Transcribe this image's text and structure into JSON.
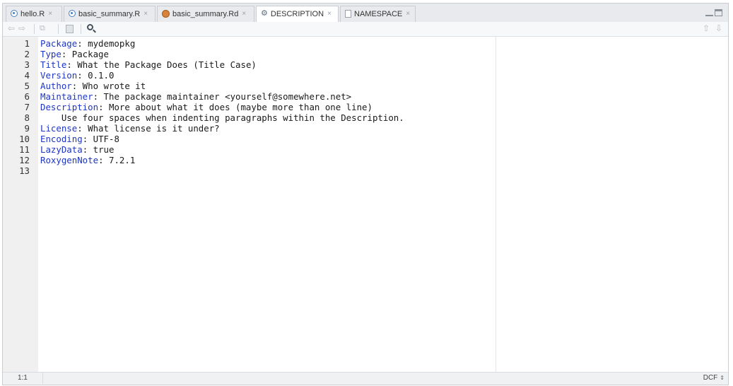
{
  "tabs": [
    {
      "label": "hello.R",
      "icon": "r-file-icon",
      "active": false
    },
    {
      "label": "basic_summary.R",
      "icon": "r-file-icon",
      "active": false
    },
    {
      "label": "basic_summary.Rd",
      "icon": "rd-file-icon",
      "active": false
    },
    {
      "label": "DESCRIPTION",
      "icon": "gear-icon",
      "active": true
    },
    {
      "label": "NAMESPACE",
      "icon": "page-icon",
      "active": false
    }
  ],
  "tab_close_glyph": "×",
  "toolbar": {
    "back_icon": "back-arrow-icon",
    "forward_icon": "forward-arrow-icon",
    "show_in_window_icon": "show-in-window-icon",
    "save_icon": "save-icon",
    "find_icon": "search-icon",
    "up_icon": "arrow-up-icon",
    "down_icon": "arrow-down-icon"
  },
  "editor": {
    "lines": [
      {
        "n": "1",
        "key": "Package",
        "rest": ": mydemopkg"
      },
      {
        "n": "2",
        "key": "Type",
        "rest": ": Package"
      },
      {
        "n": "3",
        "key": "Title",
        "rest": ": What the Package Does (Title Case)"
      },
      {
        "n": "4",
        "key": "Version",
        "rest": ": 0.1.0"
      },
      {
        "n": "5",
        "key": "Author",
        "rest": ": Who wrote it"
      },
      {
        "n": "6",
        "key": "Maintainer",
        "rest": ": The package maintainer <yourself@somewhere.net>"
      },
      {
        "n": "7",
        "key": "Description",
        "rest": ": More about what it does (maybe more than one line)"
      },
      {
        "n": "8",
        "key": "",
        "rest": "    Use four spaces when indenting paragraphs within the Description."
      },
      {
        "n": "9",
        "key": "License",
        "rest": ": What license is it under?"
      },
      {
        "n": "10",
        "key": "Encoding",
        "rest": ": UTF-8"
      },
      {
        "n": "11",
        "key": "LazyData",
        "rest": ": true"
      },
      {
        "n": "12",
        "key": "RoxygenNote",
        "rest": ": 7.2.1"
      },
      {
        "n": "13",
        "key": "",
        "rest": ""
      }
    ]
  },
  "status": {
    "cursor": "1:1",
    "file_type": "DCF",
    "file_type_arrow": "⇕"
  },
  "colors": {
    "field_key": "#1d35c6",
    "tab_bg": "#e8eaed",
    "gutter_bg": "#f0f0f0"
  }
}
